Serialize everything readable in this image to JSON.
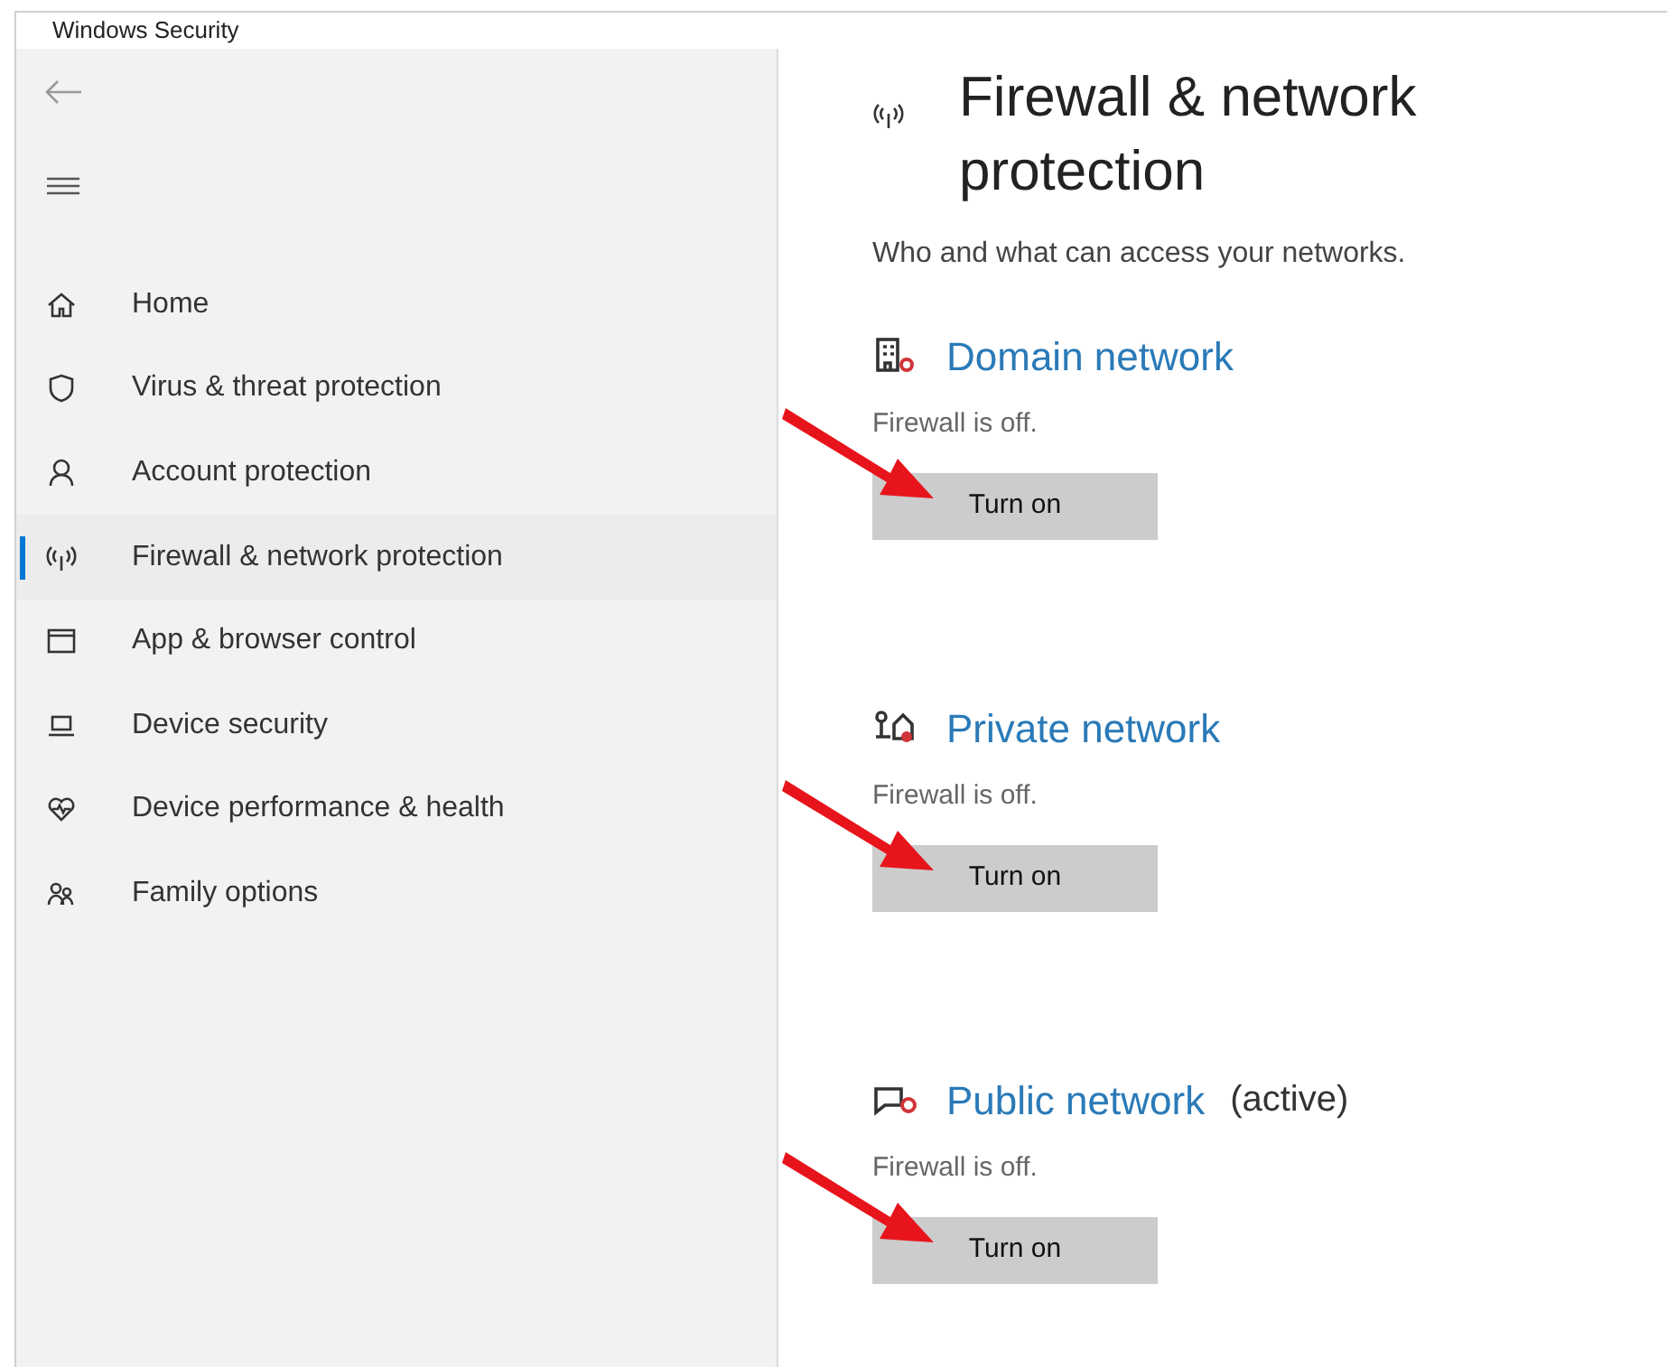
{
  "window": {
    "title": "Windows Security"
  },
  "sidebar": {
    "items": [
      {
        "kind": "home",
        "label": "Home",
        "selected": false
      },
      {
        "kind": "shield",
        "label": "Virus & threat protection",
        "selected": false
      },
      {
        "kind": "person",
        "label": "Account protection",
        "selected": false
      },
      {
        "kind": "antenna",
        "label": "Firewall & network protection",
        "selected": true
      },
      {
        "kind": "browser",
        "label": "App & browser control",
        "selected": false
      },
      {
        "kind": "laptop",
        "label": "Device security",
        "selected": false
      },
      {
        "kind": "heart",
        "label": "Device performance & health",
        "selected": false
      },
      {
        "kind": "family",
        "label": "Family options",
        "selected": false
      }
    ]
  },
  "page": {
    "title": "Firewall & network protection",
    "subtitle": "Who and what can access your networks."
  },
  "networks": [
    {
      "kind": "domain",
      "name": "Domain network",
      "status": "Firewall is off.",
      "button": "Turn on"
    },
    {
      "kind": "private",
      "name": "Private network",
      "status": "Firewall is off.",
      "button": "Turn on"
    },
    {
      "kind": "public",
      "name": "Public network",
      "badge": "(active)",
      "status": "Firewall is off.",
      "button": "Turn on"
    }
  ]
}
